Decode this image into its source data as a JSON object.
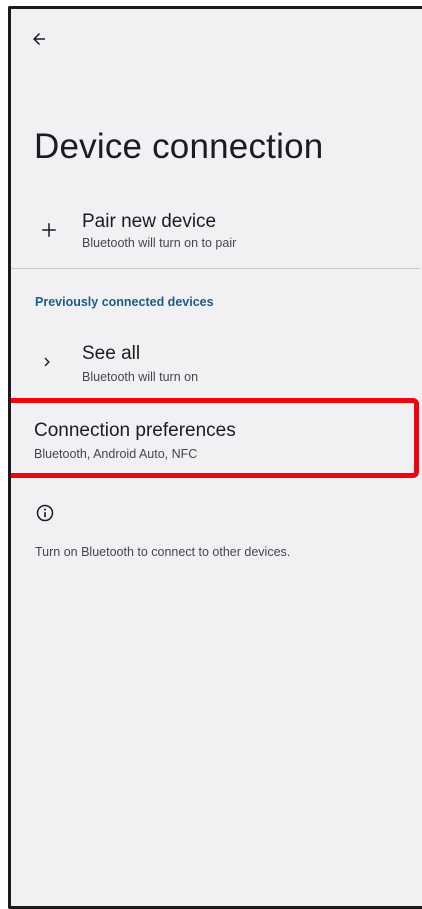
{
  "header": {
    "back_icon": "arrow-back-icon",
    "title": "Device connection"
  },
  "pair_new_device": {
    "icon": "plus-icon",
    "title": "Pair new device",
    "summary": "Bluetooth will turn on to pair"
  },
  "previously_connected": {
    "header": "Previously connected devices",
    "see_all": {
      "icon": "chevron-right-icon",
      "title": "See all",
      "summary": "Bluetooth will turn on"
    }
  },
  "connection_preferences": {
    "title": "Connection preferences",
    "summary": "Bluetooth, Android Auto, NFC",
    "highlighted": true,
    "highlight_color": "#f2020e"
  },
  "footer": {
    "icon": "info-icon",
    "text": "Turn on Bluetooth to connect to other devices."
  },
  "colors": {
    "background": "#f1f1f4",
    "text_primary": "#1c1b1f",
    "text_secondary": "#45474b",
    "section_header": "#1e5c85"
  }
}
